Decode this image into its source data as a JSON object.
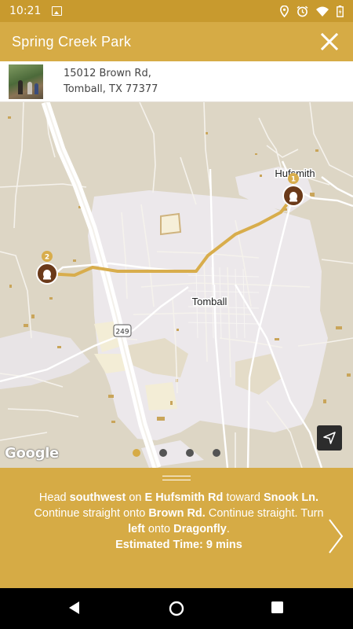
{
  "status_bar": {
    "time": "10:21",
    "icons": [
      "gallery-icon",
      "location-icon",
      "alarm-icon",
      "wifi-icon",
      "battery-icon"
    ]
  },
  "header": {
    "title": "Spring Creek Park",
    "close_icon": "close-icon",
    "background": "#d6ab45"
  },
  "location": {
    "address_line1": "15012 Brown Rd,",
    "address_line2": "Tomball, TX 77377"
  },
  "map": {
    "labels": {
      "town_main": "Tomball",
      "town_north": "Hufsmith",
      "highway_shield": "249"
    },
    "markers": [
      {
        "number": "1"
      },
      {
        "number": "2"
      }
    ],
    "route_color": "#d8ad4c",
    "attribution": "Google",
    "locate_icon": "navigation-arrow-icon",
    "page_dots": {
      "count": 4,
      "active_index": 0
    }
  },
  "directions": {
    "line_1_prefix": "Head ",
    "line_1_dir": "southwest",
    "line_1_mid": " on ",
    "line_1_road": "E Hufsmith Rd",
    "line_1_toward": " toward ",
    "line_1_target": "Snook Ln.",
    "line_2_a": " Continue straight onto ",
    "line_2_road": "Brown Rd.",
    "line_2_b": " Continue straight. Turn ",
    "line_2_turn": "left",
    "line_2_c": " onto ",
    "line_2_target": "Dragonfly",
    "line_2_end": ".",
    "estimated_time": "Estimated Time: 9 mins",
    "next_icon": "chevron-right-icon"
  },
  "nav_bar": {
    "back_icon": "back-triangle-icon",
    "home_icon": "home-circle-icon",
    "recents_icon": "recents-square-icon"
  }
}
